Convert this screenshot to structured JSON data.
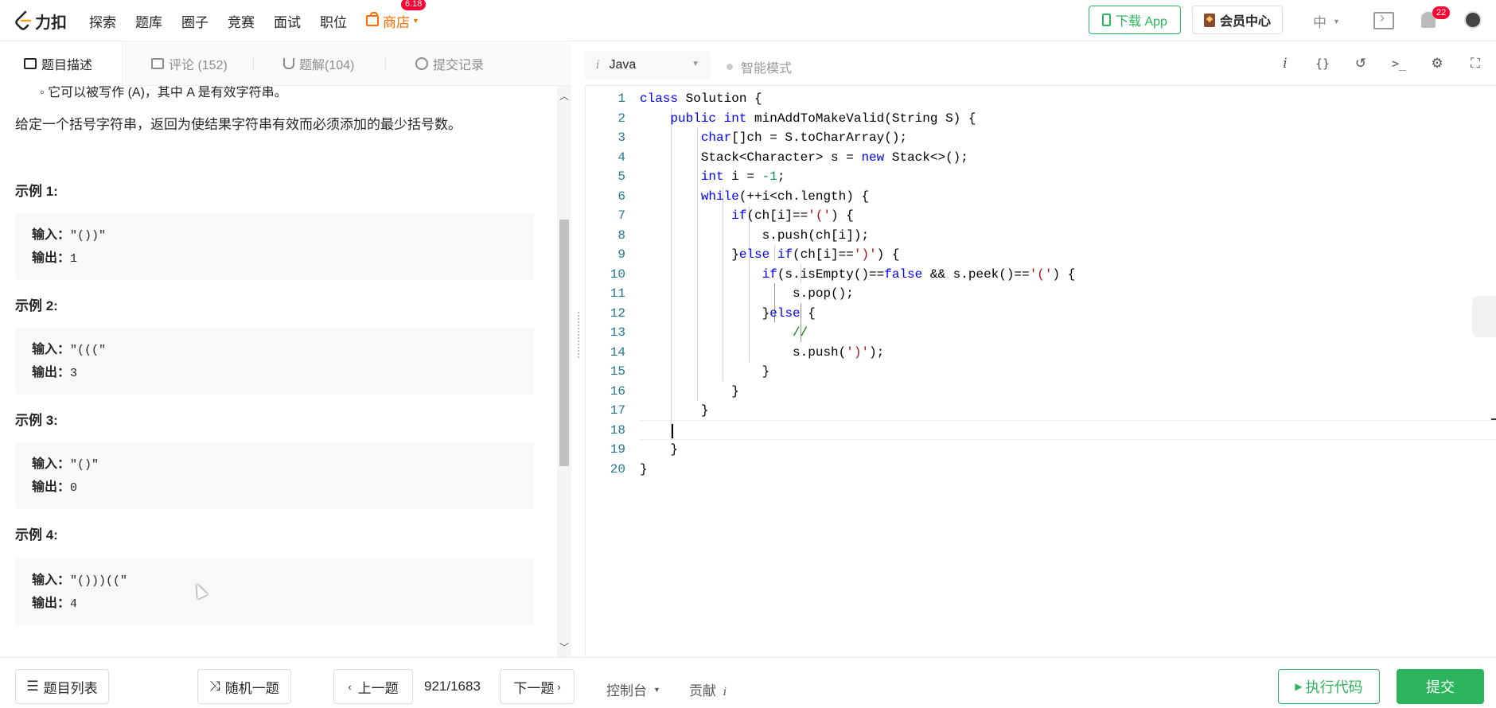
{
  "topnav": {
    "logo_text": "力扣",
    "links": [
      "探索",
      "题库",
      "圈子",
      "竞赛",
      "面试",
      "职位"
    ],
    "shop_label": "商店",
    "shop_badge": "6.18",
    "download_label": "下载 App",
    "vip_label": "会员中心",
    "lang_label": "中",
    "notification_count": "22"
  },
  "left_tabs": {
    "description": "题目描述",
    "comments": "评论 (152)",
    "solutions": "题解(104)",
    "submissions": "提交记录"
  },
  "problem": {
    "cut_text": "◦ 它可以被写作 (A)，其中 A 是有效字符串。",
    "description": "给定一个括号字符串，返回为使结果字符串有效而必须添加的最少括号数。",
    "examples": [
      {
        "title": "示例 1:",
        "input_label": "输入：",
        "input": "\"())\"",
        "output_label": "输出：",
        "output": "1"
      },
      {
        "title": "示例 2:",
        "input_label": "输入：",
        "input": "\"(((\"",
        "output_label": "输出：",
        "output": "3"
      },
      {
        "title": "示例 3:",
        "input_label": "输入：",
        "input": "\"()\"",
        "output_label": "输出：",
        "output": "0"
      },
      {
        "title": "示例 4:",
        "input_label": "输入：",
        "input": "\"()))((\"",
        "output_label": "输出：",
        "output": "4"
      }
    ]
  },
  "editor_header": {
    "language": "Java",
    "smart_mode": "智能模式"
  },
  "code": {
    "line_numbers": [
      "1",
      "2",
      "3",
      "4",
      "5",
      "6",
      "7",
      "8",
      "9",
      "10",
      "11",
      "12",
      "13",
      "14",
      "15",
      "16",
      "17",
      "18",
      "19",
      "20"
    ],
    "lines": [
      "class Solution {",
      "    public int minAddToMakeValid(String S) {",
      "        char[]ch = S.toCharArray();",
      "        Stack<Character> s = new Stack<>();",
      "        int i = -1;",
      "        while(++i<ch.length) {",
      "            if(ch[i]=='(') {",
      "                s.push(ch[i]);",
      "            }else if(ch[i]==')') {",
      "                if(s.isEmpty()==false && s.peek()=='(') {",
      "                    s.pop();",
      "                }else {",
      "                    //",
      "                    s.push(')');",
      "                }",
      "            }",
      "        }",
      "",
      "    }",
      "}"
    ]
  },
  "bottombar": {
    "problem_list": "题目列表",
    "random": "随机一题",
    "prev": "上一题",
    "counter": "921/1683",
    "next": "下一题",
    "console": "控制台",
    "contribute": "贡献",
    "run": "执行代码",
    "submit": "提交"
  },
  "colors": {
    "accent_green": "#2db55d",
    "shop_orange": "#ff6d00",
    "badge_red": "#ff0033"
  }
}
